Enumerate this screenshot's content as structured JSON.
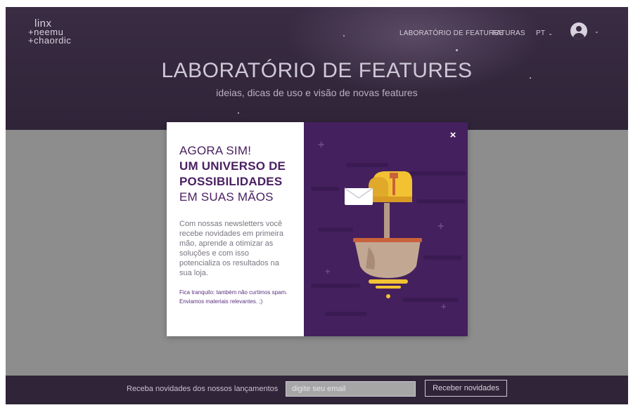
{
  "brand": {
    "logo_lines": [
      "linx",
      "+neemu",
      "+chaordic"
    ]
  },
  "nav": {
    "items": [
      {
        "label": "LABORATÓRIO DE FEATURES"
      },
      {
        "label": "FATURAS"
      },
      {
        "label": "PT"
      }
    ],
    "account_icon": "user-circle-icon",
    "chevron_icon": "chevron-down-icon"
  },
  "hero": {
    "title": "LABORATÓRIO DE FEATURES",
    "subtitle": "ideias, dicas de uso e visão de novas features"
  },
  "modal": {
    "headline": {
      "line1": "AGORA SIM!",
      "line2": "UM UNIVERSO DE",
      "line3": "POSSIBILIDADES",
      "line4": "EM SUAS MÃOS"
    },
    "description": "Com nossas newsletters você recebe novidades em primeira mão, aprende a otimizar as soluções e com isso potencializa os resultados na sua loja.",
    "note": "Fica tranquilo: também não curtimos spam. Enviamos materiais relevantes. ;)",
    "close_label": "×",
    "illustration": "mailbox-illustration"
  },
  "footer": {
    "text": "Receba novidades dos nossos lançamentos",
    "email_placeholder": "digite seu email",
    "button_label": "Receber novidades"
  },
  "colors": {
    "hero_bg": "#2f2438",
    "overlay": "#8d8d8d",
    "modal_accent": "#45205e",
    "headline": "#4a2062",
    "mailbox": "#f2c233"
  }
}
